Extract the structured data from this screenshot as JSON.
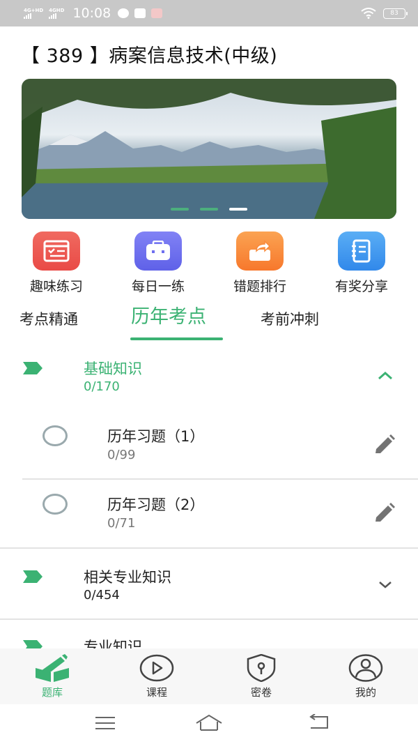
{
  "status_bar": {
    "network1": "4G+HD",
    "network2": "4GHD",
    "time": "10:08",
    "battery": "83"
  },
  "title": "【 389 】病案信息技术(中级)",
  "banner": {
    "slides": 3,
    "active_slide": 3
  },
  "quick_menu": [
    {
      "label": "趣味练习",
      "icon": "quiz-window-icon",
      "color": "#ef5a52"
    },
    {
      "label": "每日一练",
      "icon": "daily-briefcase-icon",
      "color": "#6e6ff0"
    },
    {
      "label": "错题排行",
      "icon": "ranking-share-icon",
      "color": "#f98a3a"
    },
    {
      "label": "有奖分享",
      "icon": "notebook-icon",
      "color": "#3f9af0"
    }
  ],
  "tabs": [
    {
      "label": "考点精通",
      "active": false
    },
    {
      "label": "历年考点",
      "active": true
    },
    {
      "label": "考前冲刺",
      "active": false
    }
  ],
  "chapters": [
    {
      "title": "基础知识",
      "count": "0/170",
      "expanded": true,
      "items": [
        {
          "title": "历年习题（1）",
          "count": "0/99"
        },
        {
          "title": "历年习题（2）",
          "count": "0/71"
        }
      ]
    },
    {
      "title": "相关专业知识",
      "count": "0/454",
      "expanded": false
    },
    {
      "title": "专业知识",
      "expanded": false
    }
  ],
  "bottom_nav": [
    {
      "label": "题库",
      "icon": "question-bank-icon",
      "active": true
    },
    {
      "label": "课程",
      "icon": "play-circle-icon",
      "active": false
    },
    {
      "label": "密卷",
      "icon": "shield-lock-icon",
      "active": false
    },
    {
      "label": "我的",
      "icon": "user-icon",
      "active": false
    }
  ],
  "colors": {
    "accent": "#3bb273",
    "status_bar": "#c8c8c8"
  }
}
